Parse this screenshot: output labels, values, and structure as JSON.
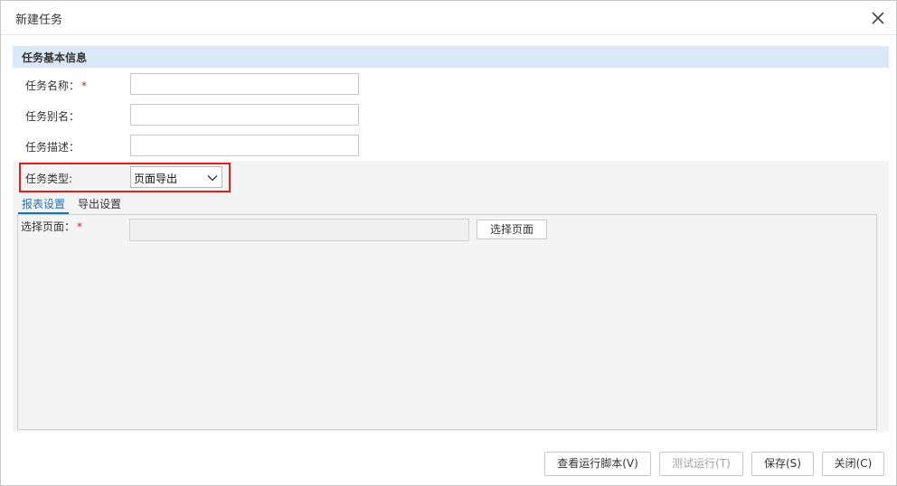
{
  "dialog": {
    "title": "新建任务"
  },
  "section": {
    "title": "任务基本信息"
  },
  "form": {
    "name_label": "任务名称：",
    "name_required": "*",
    "name_value": "",
    "alias_label": "任务别名：",
    "alias_value": "",
    "desc_label": "任务描述：",
    "desc_value": "",
    "type_label": "任务类型:",
    "type_value": "页面导出"
  },
  "tabs": [
    {
      "label": "报表设置",
      "active": true
    },
    {
      "label": "导出设置",
      "active": false
    }
  ],
  "report": {
    "page_label": "选择页面：",
    "page_required": "*",
    "page_value": "",
    "select_page_button": "选择页面"
  },
  "footer": {
    "view_script_button": "查看运行脚本(V)",
    "test_run_button": "测试运行(T)",
    "save_button": "保存(S)",
    "close_button": "关闭(C)"
  },
  "colors": {
    "section_header_bg": "#dae8f7",
    "highlight_border": "#e02020",
    "active_tab": "#1a73b8",
    "required_mark": "#e02020"
  },
  "icons": {
    "close": "close-icon",
    "dropdown": "chevron-down-icon"
  }
}
